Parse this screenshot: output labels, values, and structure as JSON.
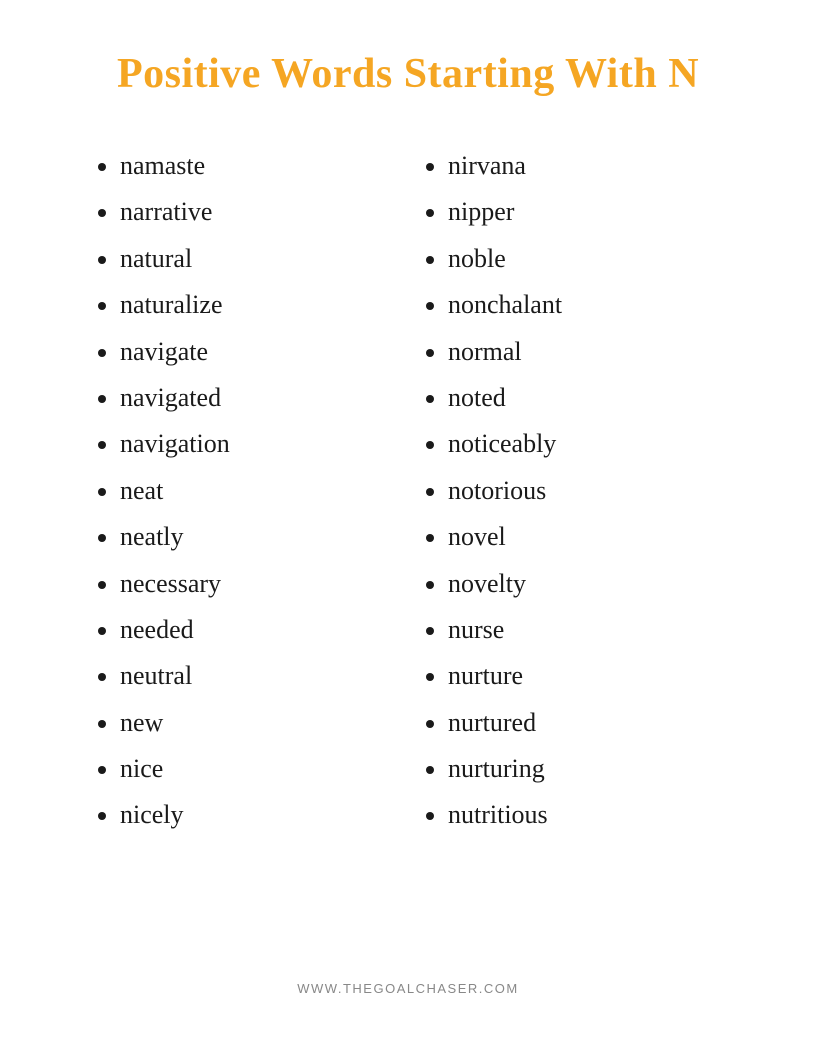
{
  "title": "Positive Words Starting With N",
  "left_column": [
    "namaste",
    "narrative",
    "natural",
    "naturalize",
    "navigate",
    "navigated",
    "navigation",
    "neat",
    "neatly",
    "necessary",
    "needed",
    "neutral",
    "new",
    "nice",
    "nicely"
  ],
  "right_column": [
    "nirvana",
    "nipper",
    "noble",
    "nonchalant",
    "normal",
    "noted",
    "noticeably",
    "notorious",
    "novel",
    "novelty",
    "nurse",
    "nurture",
    "nurtured",
    "nurturing",
    "nutritious"
  ],
  "footer": "WWW.THEGOALCHASER.COM"
}
